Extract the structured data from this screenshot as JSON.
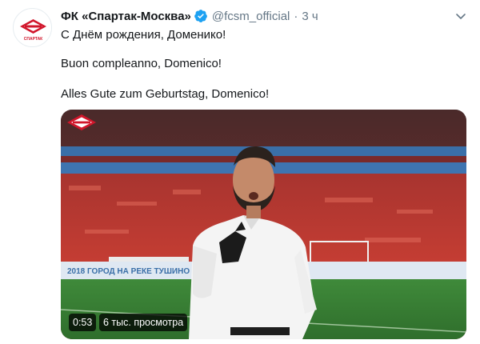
{
  "tweet": {
    "author_name": "ФК «Спартак-Москва»",
    "handle": "@fcsm_official",
    "separator": "·",
    "time_ago": "3 ч",
    "lines": [
      "С Днём рождения, Доменико!",
      "Buon compleanno, Domenico!",
      "Alles Gute zum Geburtstag, Domenico!"
    ]
  },
  "icons": {
    "verified": "verified-badge-icon",
    "menu": "chevron-down-icon"
  },
  "video": {
    "duration": "0:53",
    "views": "6 тыс. просмотра",
    "ad_board_text": "2018 ГОРОД НА РЕКЕ ТУШИНО"
  },
  "colors": {
    "verified_blue": "#1da1f2",
    "spartak_red": "#d1162b",
    "handle_gray": "#657786"
  }
}
